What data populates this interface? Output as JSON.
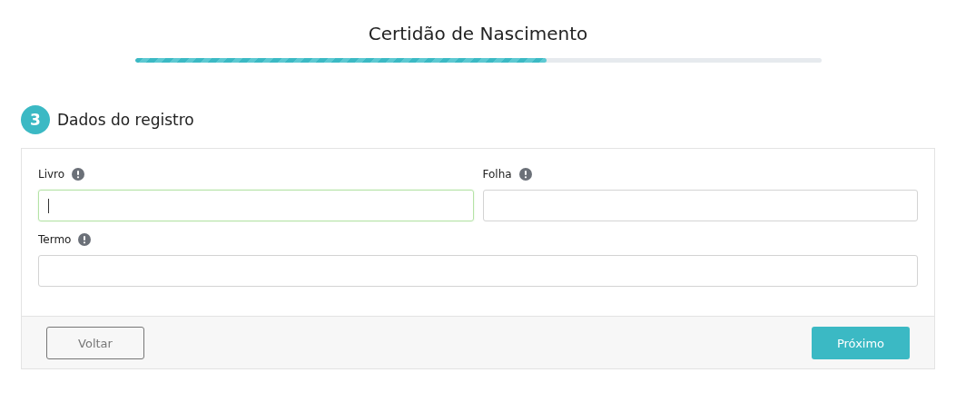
{
  "title": "Certidão de Nascimento",
  "progress": {
    "level": 0.6
  },
  "step": {
    "number": "3",
    "title": "Dados do registro"
  },
  "field_rows": [
    [
      {
        "label": "Livro",
        "focused": true
      },
      {
        "label": "Folha",
        "focused": false
      }
    ],
    [
      {
        "label": "Termo",
        "focused": false
      }
    ]
  ],
  "buttons": {
    "back": "Voltar",
    "next": "Próximo"
  }
}
